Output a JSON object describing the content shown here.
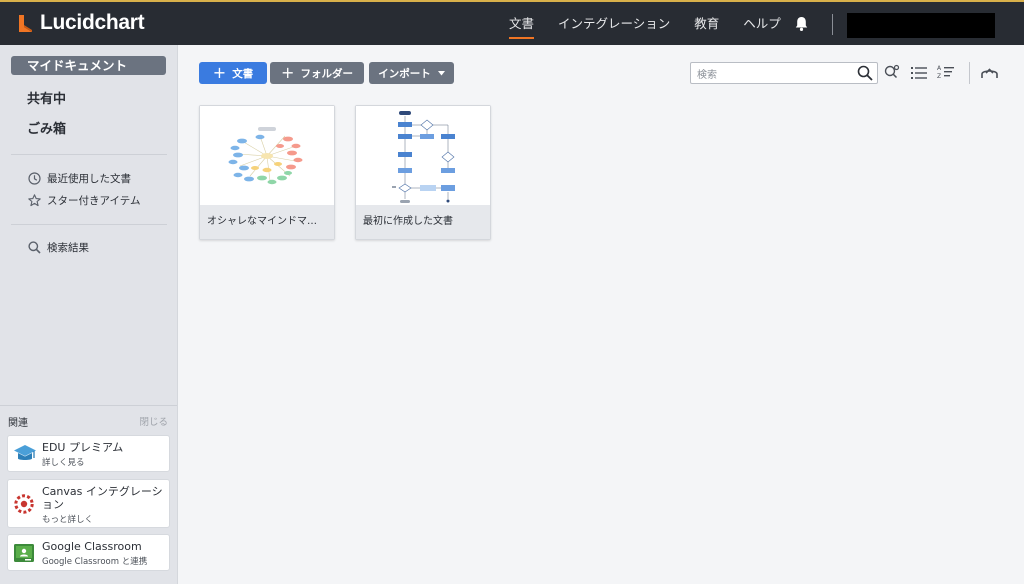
{
  "app": {
    "brand": "Lucidchart",
    "accent": "#f07524",
    "primary": "#3a7be0"
  },
  "topnav": {
    "items": [
      {
        "label": "文書",
        "active": true
      },
      {
        "label": "インテグレーション",
        "active": false
      },
      {
        "label": "教育",
        "active": false
      },
      {
        "label": "ヘルプ",
        "active": false
      }
    ],
    "bell_icon": "bell-icon"
  },
  "sidebar": {
    "my_documents": "マイドキュメント",
    "shared": "共有中",
    "trash": "ごみ箱",
    "recent": "最近使用した文書",
    "starred": "スター付きアイテム",
    "search_results": "検索結果"
  },
  "related": {
    "title": "関連",
    "close": "閉じる",
    "cards": [
      {
        "title": "EDU プレミアム",
        "subtitle": "詳しく見る",
        "icon": "graduation-cap-icon"
      },
      {
        "title": "Canvas インテグレーション",
        "subtitle": "もっと詳しく",
        "icon": "canvas-icon"
      },
      {
        "title": "Google Classroom",
        "subtitle": "Google Classroom と連携",
        "icon": "google-classroom-icon"
      }
    ]
  },
  "toolbar": {
    "new_document": "文書",
    "new_folder": "フォルダー",
    "import": "インポート",
    "search_placeholder": "検索"
  },
  "documents": [
    {
      "name": "オシャレなマインドマ…",
      "thumbnail": "mind-map"
    },
    {
      "name": "最初に作成した文書",
      "thumbnail": "flowchart"
    }
  ]
}
